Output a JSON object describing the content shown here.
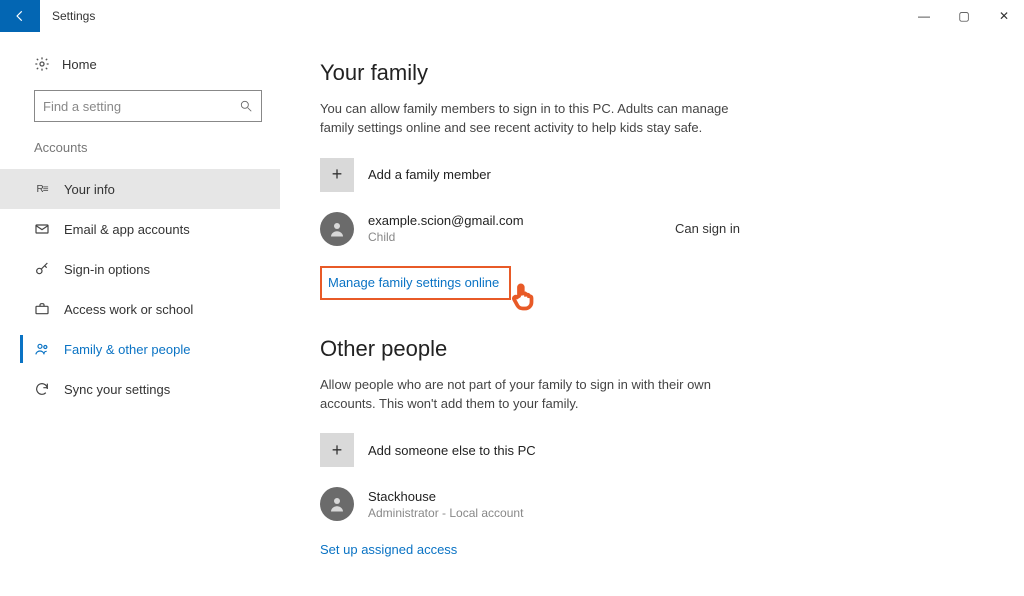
{
  "window": {
    "title": "Settings"
  },
  "sidebar": {
    "home": "Home",
    "search_placeholder": "Find a setting",
    "group_label": "Accounts",
    "items": [
      {
        "icon": "R≡",
        "label": "Your info"
      },
      {
        "icon": "mail",
        "label": "Email & app accounts"
      },
      {
        "icon": "key",
        "label": "Sign-in options"
      },
      {
        "icon": "briefcase",
        "label": "Access work or school"
      },
      {
        "icon": "people",
        "label": "Family & other people"
      },
      {
        "icon": "sync",
        "label": "Sync your settings"
      }
    ]
  },
  "content": {
    "family": {
      "heading": "Your family",
      "desc": "You can allow family members to sign in to this PC. Adults can manage family settings online and see recent activity to help kids stay safe.",
      "add_label": "Add a family member",
      "member": {
        "email": "example.scion@gmail.com",
        "role": "Child",
        "status": "Can sign in"
      },
      "manage_link": "Manage family settings online"
    },
    "other": {
      "heading": "Other people",
      "desc": "Allow people who are not part of your family to sign in with their own accounts. This won't add them to your family.",
      "add_label": "Add someone else to this PC",
      "member": {
        "name": "Stackhouse",
        "role": "Administrator - Local account"
      },
      "assigned_link": "Set up assigned access"
    }
  }
}
